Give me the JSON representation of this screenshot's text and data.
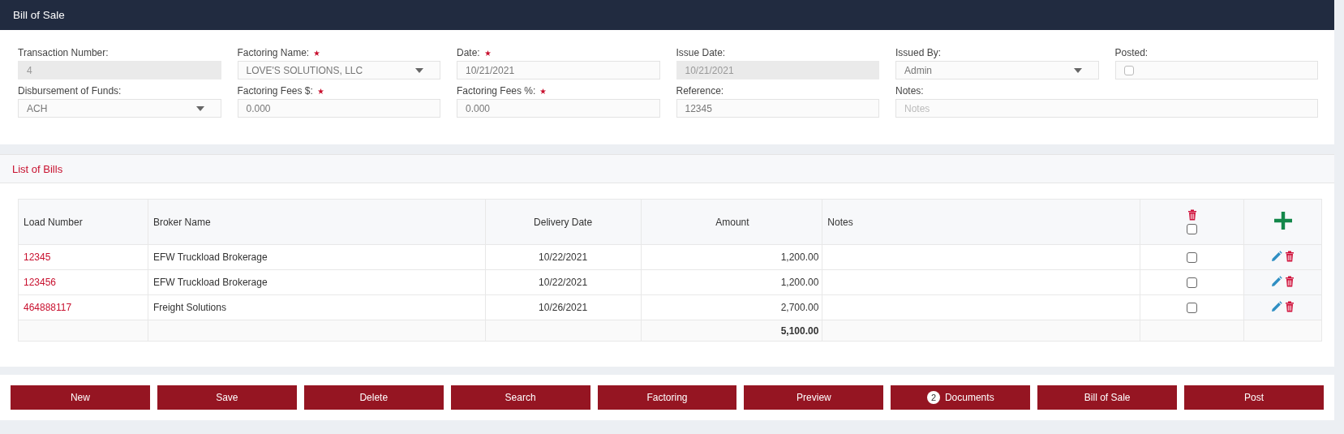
{
  "window": {
    "title": "Bill of Sale"
  },
  "form": {
    "fields": [
      {
        "label": "Transaction Number:",
        "required": false,
        "kind": "text",
        "value": "4",
        "disabled": true
      },
      {
        "label": "Factoring Name:",
        "required": true,
        "kind": "select",
        "value": "LOVE'S SOLUTIONS, LLC",
        "disabled": false
      },
      {
        "label": "Date:",
        "required": true,
        "kind": "text",
        "value": "10/21/2021",
        "disabled": false
      },
      {
        "label": "Issue Date:",
        "required": false,
        "kind": "text",
        "value": "10/21/2021",
        "disabled": true
      },
      {
        "label": "Issued By:",
        "required": false,
        "kind": "select",
        "value": "Admin",
        "disabled": false
      },
      {
        "label": "Posted:",
        "required": false,
        "kind": "checkbox",
        "checked": false,
        "disabled": false
      },
      {
        "label": "Disbursement of Funds:",
        "required": false,
        "kind": "select",
        "value": "ACH",
        "disabled": false
      },
      {
        "label": "Factoring Fees $:",
        "required": true,
        "kind": "text",
        "value": "0.000",
        "disabled": false
      },
      {
        "label": "Factoring Fees %:",
        "required": true,
        "kind": "text",
        "value": "0.000",
        "disabled": false
      },
      {
        "label": "Reference:",
        "required": false,
        "kind": "text",
        "value": "12345",
        "disabled": false
      },
      {
        "label": "Notes:",
        "required": false,
        "kind": "text",
        "placeholder": "Notes",
        "disabled": false
      }
    ]
  },
  "bills": {
    "title": "List of Bills",
    "columns": [
      "Load Number",
      "Broker Name",
      "Delivery Date",
      "Amount",
      "Notes"
    ],
    "header_checked": false,
    "rows": [
      {
        "load_number": "12345",
        "broker_name": "EFW Truckload Brokerage",
        "delivery_date": "10/22/2021",
        "amount": "1,200.00",
        "checked": false
      },
      {
        "load_number": "123456",
        "broker_name": "EFW Truckload Brokerage",
        "delivery_date": "10/22/2021",
        "amount": "1,200.00",
        "checked": false
      },
      {
        "load_number": "464888117",
        "broker_name": "Freight Solutions",
        "delivery_date": "10/26/2021",
        "amount": "2,700.00",
        "checked": false
      }
    ],
    "total": "5,100.00"
  },
  "buttons": [
    {
      "label": "New"
    },
    {
      "label": "Save"
    },
    {
      "label": "Delete"
    },
    {
      "label": "Search"
    },
    {
      "label": "Factoring"
    },
    {
      "label": "Preview"
    },
    {
      "label": "Documents",
      "badge": "2"
    },
    {
      "label": "Bill of Sale"
    },
    {
      "label": "Post"
    }
  ]
}
